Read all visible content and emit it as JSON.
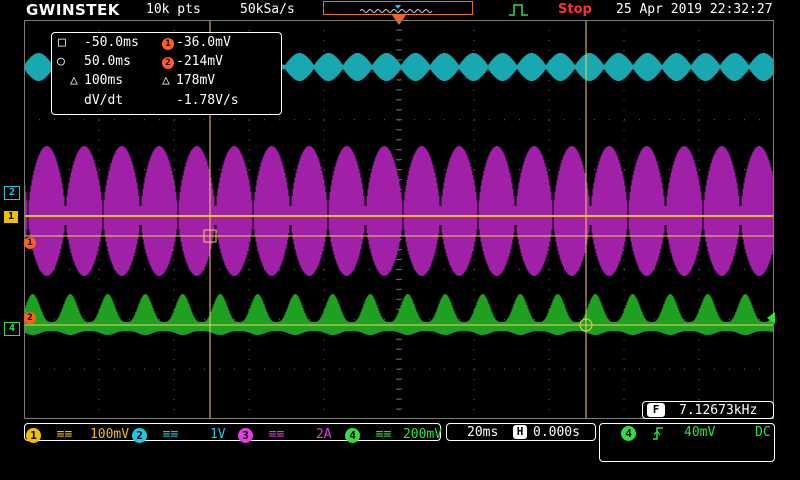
{
  "header": {
    "logo": "GWINSTEK",
    "record_length": "10k pts",
    "sample_rate": "50kSa/s",
    "status": "Stop",
    "datetime": "25 Apr 2019 22:32:27"
  },
  "cursor_readout": {
    "t1": "-50.0ms",
    "t2": "50.0ms",
    "dt": "100ms",
    "v1": "-36.0mV",
    "v2": "-214mV",
    "dv": "178mV",
    "dvdt_label": "dV/dt",
    "dvdt_value": "-1.78V/s",
    "v1_num": "1",
    "v2_num": "2"
  },
  "channel_markers": {
    "ch2": "2",
    "ch1": "1",
    "ch4": "4",
    "cursor1": "1",
    "cursor2": "2"
  },
  "frequency_counter": {
    "label": "F",
    "value": "7.12673kHz"
  },
  "bottom_bar": {
    "ch1": {
      "num": "1",
      "scale": "100mV",
      "color": "#f0c000"
    },
    "ch2": {
      "num": "2",
      "scale": "1V",
      "color": "#20c8e0"
    },
    "ch3": {
      "num": "3",
      "scale": "2A",
      "color": "#e040e0"
    },
    "ch4": {
      "num": "4",
      "scale": "200mV",
      "color": "#30e040"
    },
    "timebase": "20ms",
    "h_label": "H",
    "h_position": "0.000s",
    "trigger": {
      "num": "4",
      "level": "40mV",
      "coupling": "DC"
    }
  },
  "colors": {
    "ch1": "#d8c020",
    "ch2": "#1aa8b0",
    "ch3": "#a020a8",
    "ch4": "#20a020",
    "cursor": "#f0d060",
    "accent": "#ff6020"
  }
}
